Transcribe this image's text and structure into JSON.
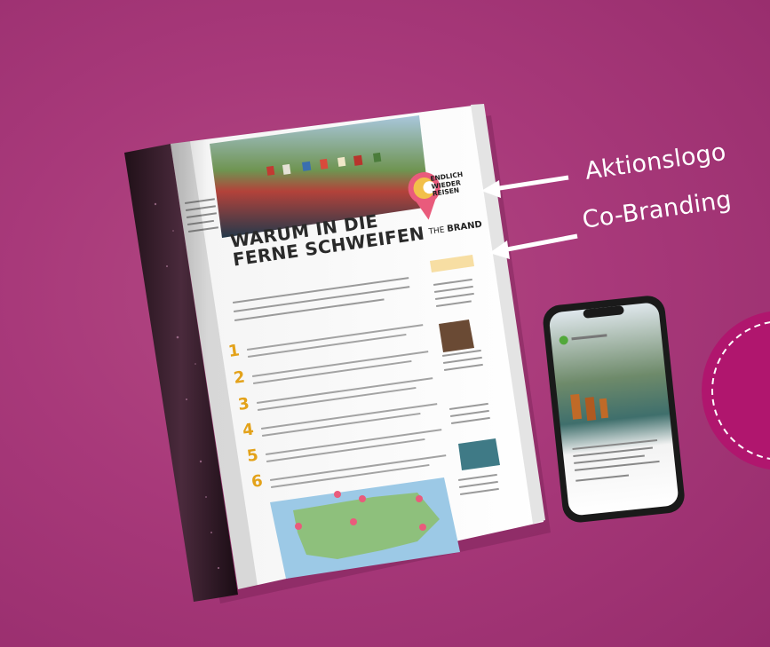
{
  "annotations": {
    "aktionslogo": "Aktionslogo",
    "cobranding": "Co-Branding"
  },
  "magazine": {
    "headline_line1": "WARUM IN DIE",
    "headline_line2": "FERNE SCHWEIFEN",
    "logo_line1": "ENDLICH",
    "logo_line2": "WIEDER",
    "logo_line3": "REISEN",
    "brand_prefix": "THE",
    "brand_word": "BRAND"
  },
  "colors": {
    "background": "#a8397a",
    "arrow": "#ffffff",
    "accent_gold": "#e3a21a",
    "logo_pink": "#e95b7c"
  }
}
